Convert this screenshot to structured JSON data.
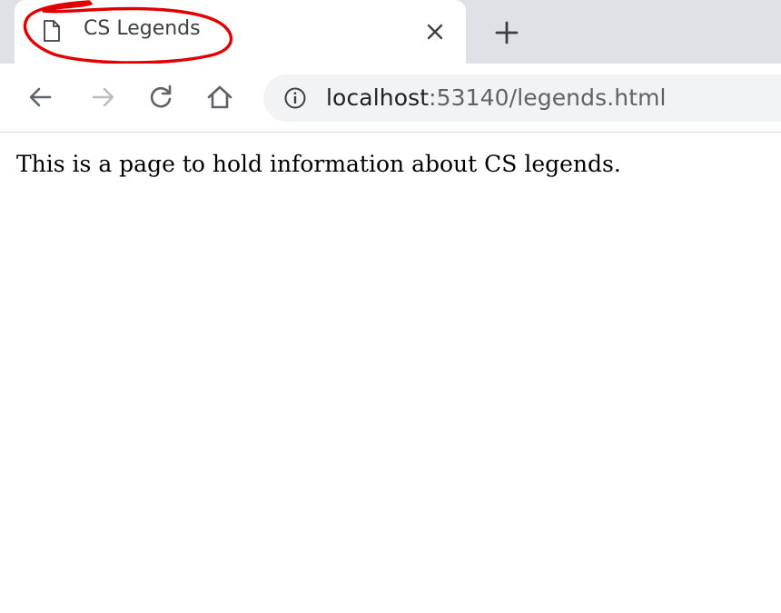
{
  "tab": {
    "title": "CS Legends",
    "favicon": "document-icon",
    "close_icon": "close-icon"
  },
  "new_tab_icon": "plus-icon",
  "toolbar": {
    "back_icon": "arrow-left-icon",
    "forward_icon": "arrow-right-icon",
    "reload_icon": "reload-icon",
    "home_icon": "home-icon"
  },
  "omnibox": {
    "security_icon": "info-icon",
    "host": "localhost",
    "path": ":53140/legends.html"
  },
  "page": {
    "text": "This is a page to hold information about CS legends."
  },
  "colors": {
    "tab_strip": "#dee1e6",
    "omnibox_bg": "#f1f3f4",
    "annotation_red": "#e00000",
    "url_path": "#5f6368"
  }
}
